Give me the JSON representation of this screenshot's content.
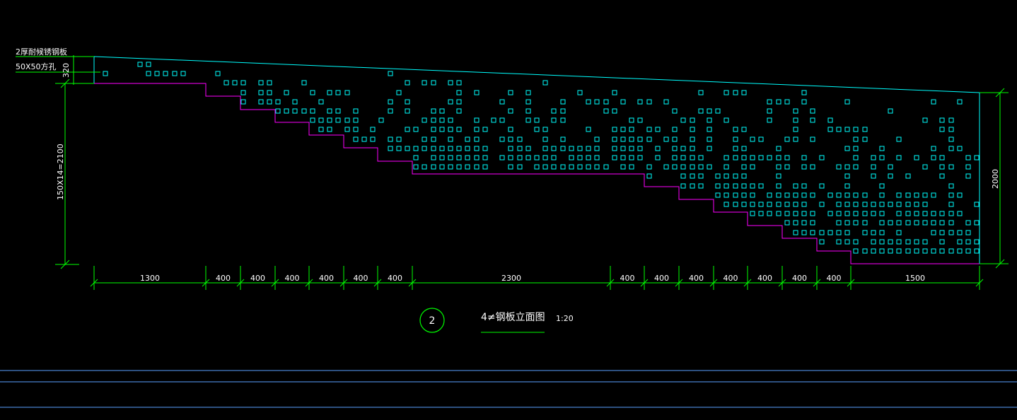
{
  "drawing": {
    "label_plate": "2厚耐候锈钢板",
    "label_holes": "50X50方孔",
    "dim_top": "320",
    "dim_left": "150X14=2100",
    "dim_right": "2000",
    "bottom_dims": [
      "1300",
      "400",
      "400",
      "400",
      "400",
      "400",
      "400",
      "2300",
      "400",
      "400",
      "400",
      "400",
      "400",
      "400",
      "400",
      "1500"
    ],
    "callout_number": "2",
    "title": "4≠钢板立面图",
    "scale": "1:20"
  },
  "colors": {
    "background": "#000000",
    "outline": "#00ffff",
    "dimension": "#00ff00",
    "step_line": "#ff00ff",
    "text": "#ffffff",
    "rails": "#5aa0ff"
  }
}
